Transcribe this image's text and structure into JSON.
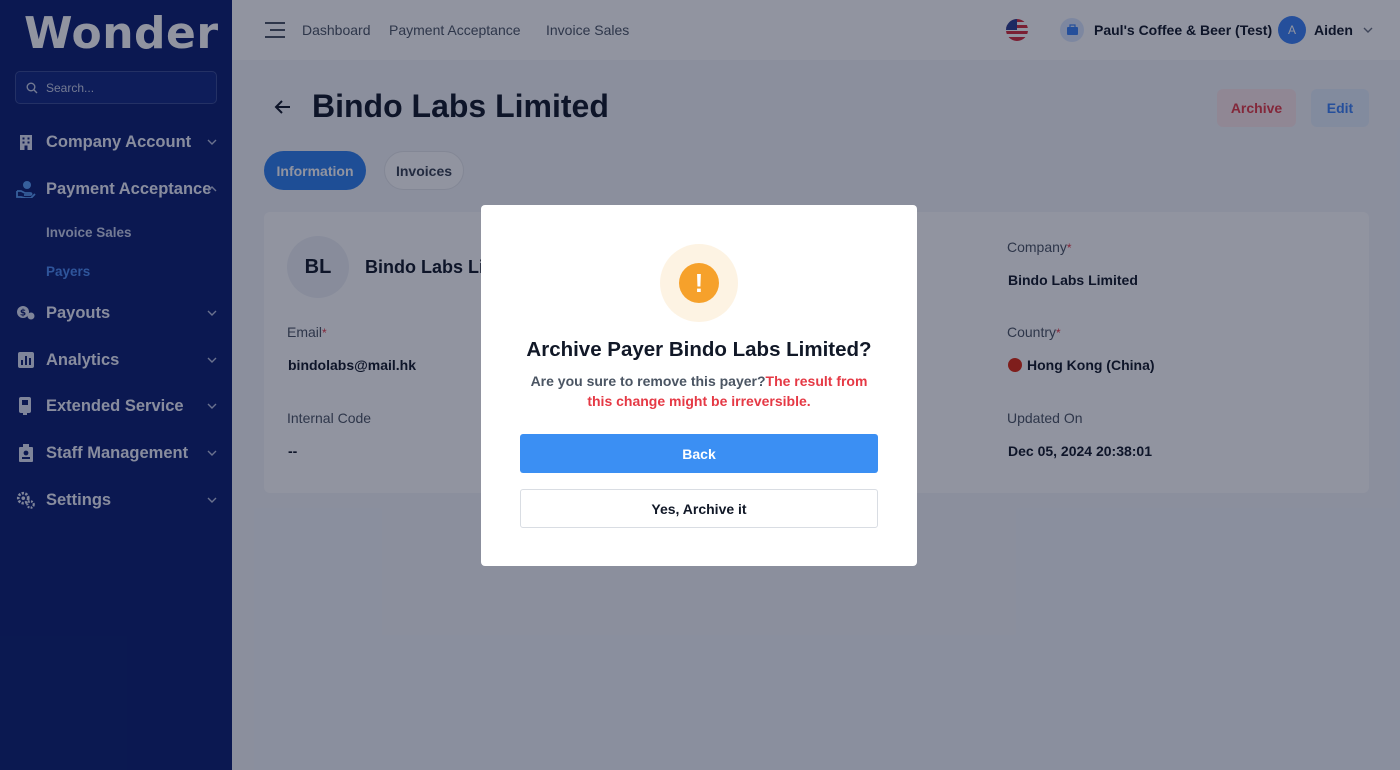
{
  "app": {
    "logo": "Wonder"
  },
  "search": {
    "placeholder": "Search..."
  },
  "sidebar": {
    "items": [
      {
        "label": "Company Account",
        "icon": "building-icon"
      },
      {
        "label": "Payment Acceptance",
        "icon": "hand-coin-icon",
        "expanded": true,
        "children": [
          {
            "label": "Invoice Sales"
          },
          {
            "label": "Payers",
            "active": true
          }
        ]
      },
      {
        "label": "Payouts",
        "icon": "coins-icon"
      },
      {
        "label": "Analytics",
        "icon": "bar-chart-icon"
      },
      {
        "label": "Extended Service",
        "icon": "service-icon"
      },
      {
        "label": "Staff Management",
        "icon": "staff-icon"
      },
      {
        "label": "Settings",
        "icon": "gears-icon"
      }
    ]
  },
  "topbar": {
    "breadcrumbs": [
      "Dashboard",
      "Payment Acceptance",
      "Invoice Sales"
    ],
    "shop_name": "Paul's Coffee & Beer (Test)",
    "user_initial": "A",
    "user_name": "Aiden"
  },
  "page": {
    "title": "Bindo Labs Limited",
    "archive_label": "Archive",
    "edit_label": "Edit",
    "tabs": [
      "Information",
      "Invoices"
    ],
    "avatar_initials": "BL",
    "payer_name": "Bindo Labs Limited",
    "fields": {
      "email_label": "Email",
      "email_value": "bindolabs@mail.hk",
      "internal_code_label": "Internal Code",
      "internal_code_value": "--",
      "company_label": "Company",
      "company_value": "Bindo Labs Limited",
      "country_label": "Country",
      "country_value": "Hong Kong (China)",
      "updated_label": "Updated On",
      "updated_value": "Dec 05, 2024 20:38:01",
      "required_mark": "*"
    }
  },
  "modal": {
    "title": "Archive Payer Bindo Labs Limited?",
    "message": "Are you sure to remove this payer?",
    "warning": "The result from this change might be irreversible.",
    "back_label": "Back",
    "confirm_label": "Yes, Archive it"
  },
  "colors": {
    "sidebar_bg": "#0b1e6f",
    "primary": "#3b8ff3",
    "danger": "#e53945",
    "warning": "#f6a12b",
    "active_sub": "#4d8df6"
  }
}
